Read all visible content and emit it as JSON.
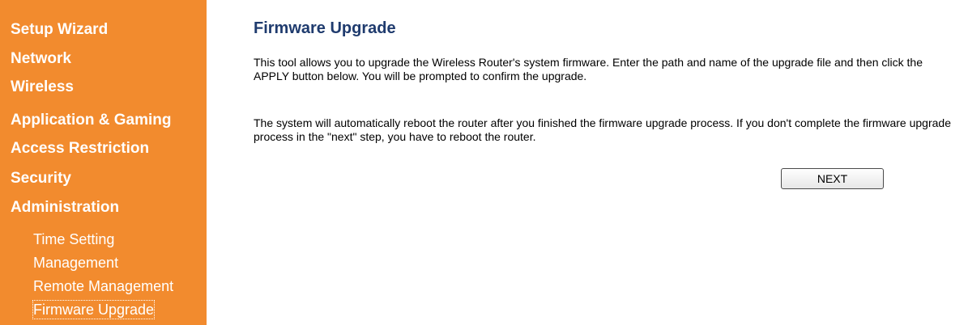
{
  "sidebar": {
    "items": [
      {
        "label": "Setup Wizard"
      },
      {
        "label": "Network"
      },
      {
        "label": "Wireless"
      },
      {
        "label": "Application & Gaming"
      },
      {
        "label": "Access Restriction"
      },
      {
        "label": "Security"
      },
      {
        "label": "Administration"
      }
    ],
    "subitems": [
      {
        "label": "Time Setting"
      },
      {
        "label": "Management"
      },
      {
        "label": "Remote Management"
      },
      {
        "label": "Firmware Upgrade",
        "active": true
      }
    ]
  },
  "main": {
    "title": "Firmware Upgrade",
    "paragraph1": "This tool allows you to upgrade the Wireless Router's system firmware. Enter the path and name of the upgrade file and then click the APPLY button below. You will be prompted to confirm the upgrade.",
    "paragraph2": "The system will automatically reboot the router after you finished the firmware upgrade process. If you don't complete the firmware upgrade process in the \"next\" step, you have to reboot the router.",
    "next_label": "NEXT"
  },
  "colors": {
    "sidebar_bg": "#f28b2e",
    "title": "#1f3b6e"
  }
}
